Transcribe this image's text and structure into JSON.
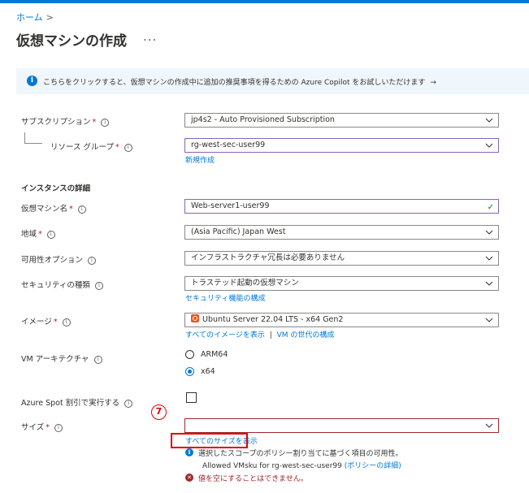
{
  "breadcrumb": {
    "home": "ホーム",
    "sep": ">"
  },
  "page": {
    "title": "仮想マシンの作成",
    "more": "..."
  },
  "banner": {
    "text": "こちらをクリックすると、仮想マシンの作成中に追加の推奨事項を得るための Azure Copilot をお試しいただけます",
    "arrow": "→"
  },
  "fields": {
    "subscription": {
      "label": "サブスクリプション",
      "value": "jp4s2 - Auto Provisioned Subscription"
    },
    "resource_group": {
      "label": "リソース グループ",
      "value": "rg-west-sec-user99",
      "create_link": "新規作成"
    },
    "section_instance": "インスタンスの詳細",
    "vm_name": {
      "label": "仮想マシン名",
      "value": "Web-server1-user99"
    },
    "region": {
      "label": "地域",
      "value": "(Asia Pacific) Japan West"
    },
    "availability": {
      "label": "可用性オプション",
      "value": "インフラストラクチャ冗長は必要ありません"
    },
    "security": {
      "label": "セキュリティの種類",
      "value": "トラステッド起動の仮想マシン",
      "link": "セキュリティ機能の構成"
    },
    "image": {
      "label": "イメージ",
      "value": "Ubuntu Server 22.04 LTS - x64 Gen2",
      "link_all": "すべてのイメージを表示",
      "link_sep": "|",
      "link_gen": "VM の世代の構成"
    },
    "arch": {
      "label": "VM アーキテクチャ",
      "options": [
        "ARM64",
        "x64"
      ],
      "selected": "x64"
    },
    "spot": {
      "label": "Azure Spot 割引で実行する"
    },
    "size": {
      "label": "サイズ",
      "value": "",
      "link_all": "すべてのサイズを表示"
    }
  },
  "required_mark": "*",
  "info_glyph": "i",
  "annotation": {
    "number": "7"
  },
  "messages": {
    "info_line1": "選択したスコープのポリシー割り当てに基づく項目の可用性。",
    "info_line2": "Allowed VMsku for rg-west-sec-user99",
    "info_link": "(ポリシーの詳細)",
    "error": "値を空にすることはできません。",
    "error_glyph": "✕",
    "info_glyph": "i"
  },
  "check_glyph": "✓",
  "colors": {
    "accent": "#0078d4",
    "error": "#a4262c",
    "annotation": "#e00000",
    "valid": "#107c10"
  }
}
